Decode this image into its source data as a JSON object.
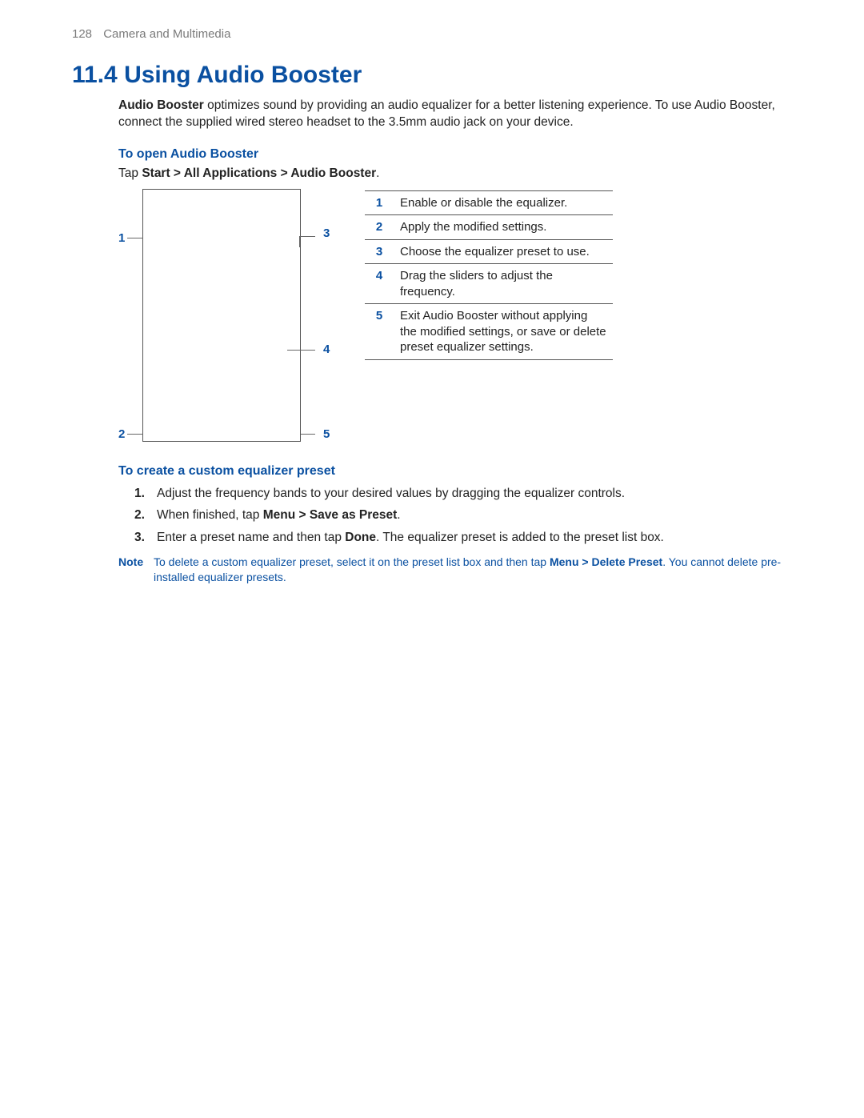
{
  "header": {
    "page_number": "128",
    "section": "Camera and Multimedia"
  },
  "title": "11.4  Using Audio Booster",
  "intro": {
    "lead_bold": "Audio Booster",
    "text_after": " optimizes sound by providing an audio equalizer for a better listening experience. To use Audio Booster, connect the supplied wired stereo headset to the 3.5mm audio jack on your device."
  },
  "sec_open": {
    "heading": "To open Audio Booster",
    "tap_prefix": "Tap ",
    "tap_path": "Start > All Applications > Audio Booster",
    "tap_suffix": "."
  },
  "callouts": {
    "c1": "1",
    "c2": "2",
    "c3": "3",
    "c4": "4",
    "c5": "5"
  },
  "legend": [
    {
      "n": "1",
      "d": "Enable or disable the equalizer."
    },
    {
      "n": "2",
      "d": "Apply the modified settings."
    },
    {
      "n": "3",
      "d": "Choose the equalizer preset to use."
    },
    {
      "n": "4",
      "d": "Drag the sliders to adjust the frequency."
    },
    {
      "n": "5",
      "d": "Exit Audio Booster without applying the modified settings, or save or delete preset equalizer settings."
    }
  ],
  "sec_custom": {
    "heading": "To create a custom equalizer preset",
    "steps": {
      "s1": "Adjust the frequency bands to your desired values by dragging the equalizer controls.",
      "s2_pre": "When finished, tap ",
      "s2_bold": "Menu > Save as Preset",
      "s2_post": ".",
      "s3_pre": "Enter a preset name and then tap ",
      "s3_bold": "Done",
      "s3_post": ". The equalizer preset is added to the preset list box."
    }
  },
  "note": {
    "label": "Note",
    "pre": "To delete a custom equalizer preset, select it on the preset list box and then tap ",
    "bold": "Menu > Delete Preset",
    "post": ". You cannot delete pre-installed equalizer presets."
  }
}
